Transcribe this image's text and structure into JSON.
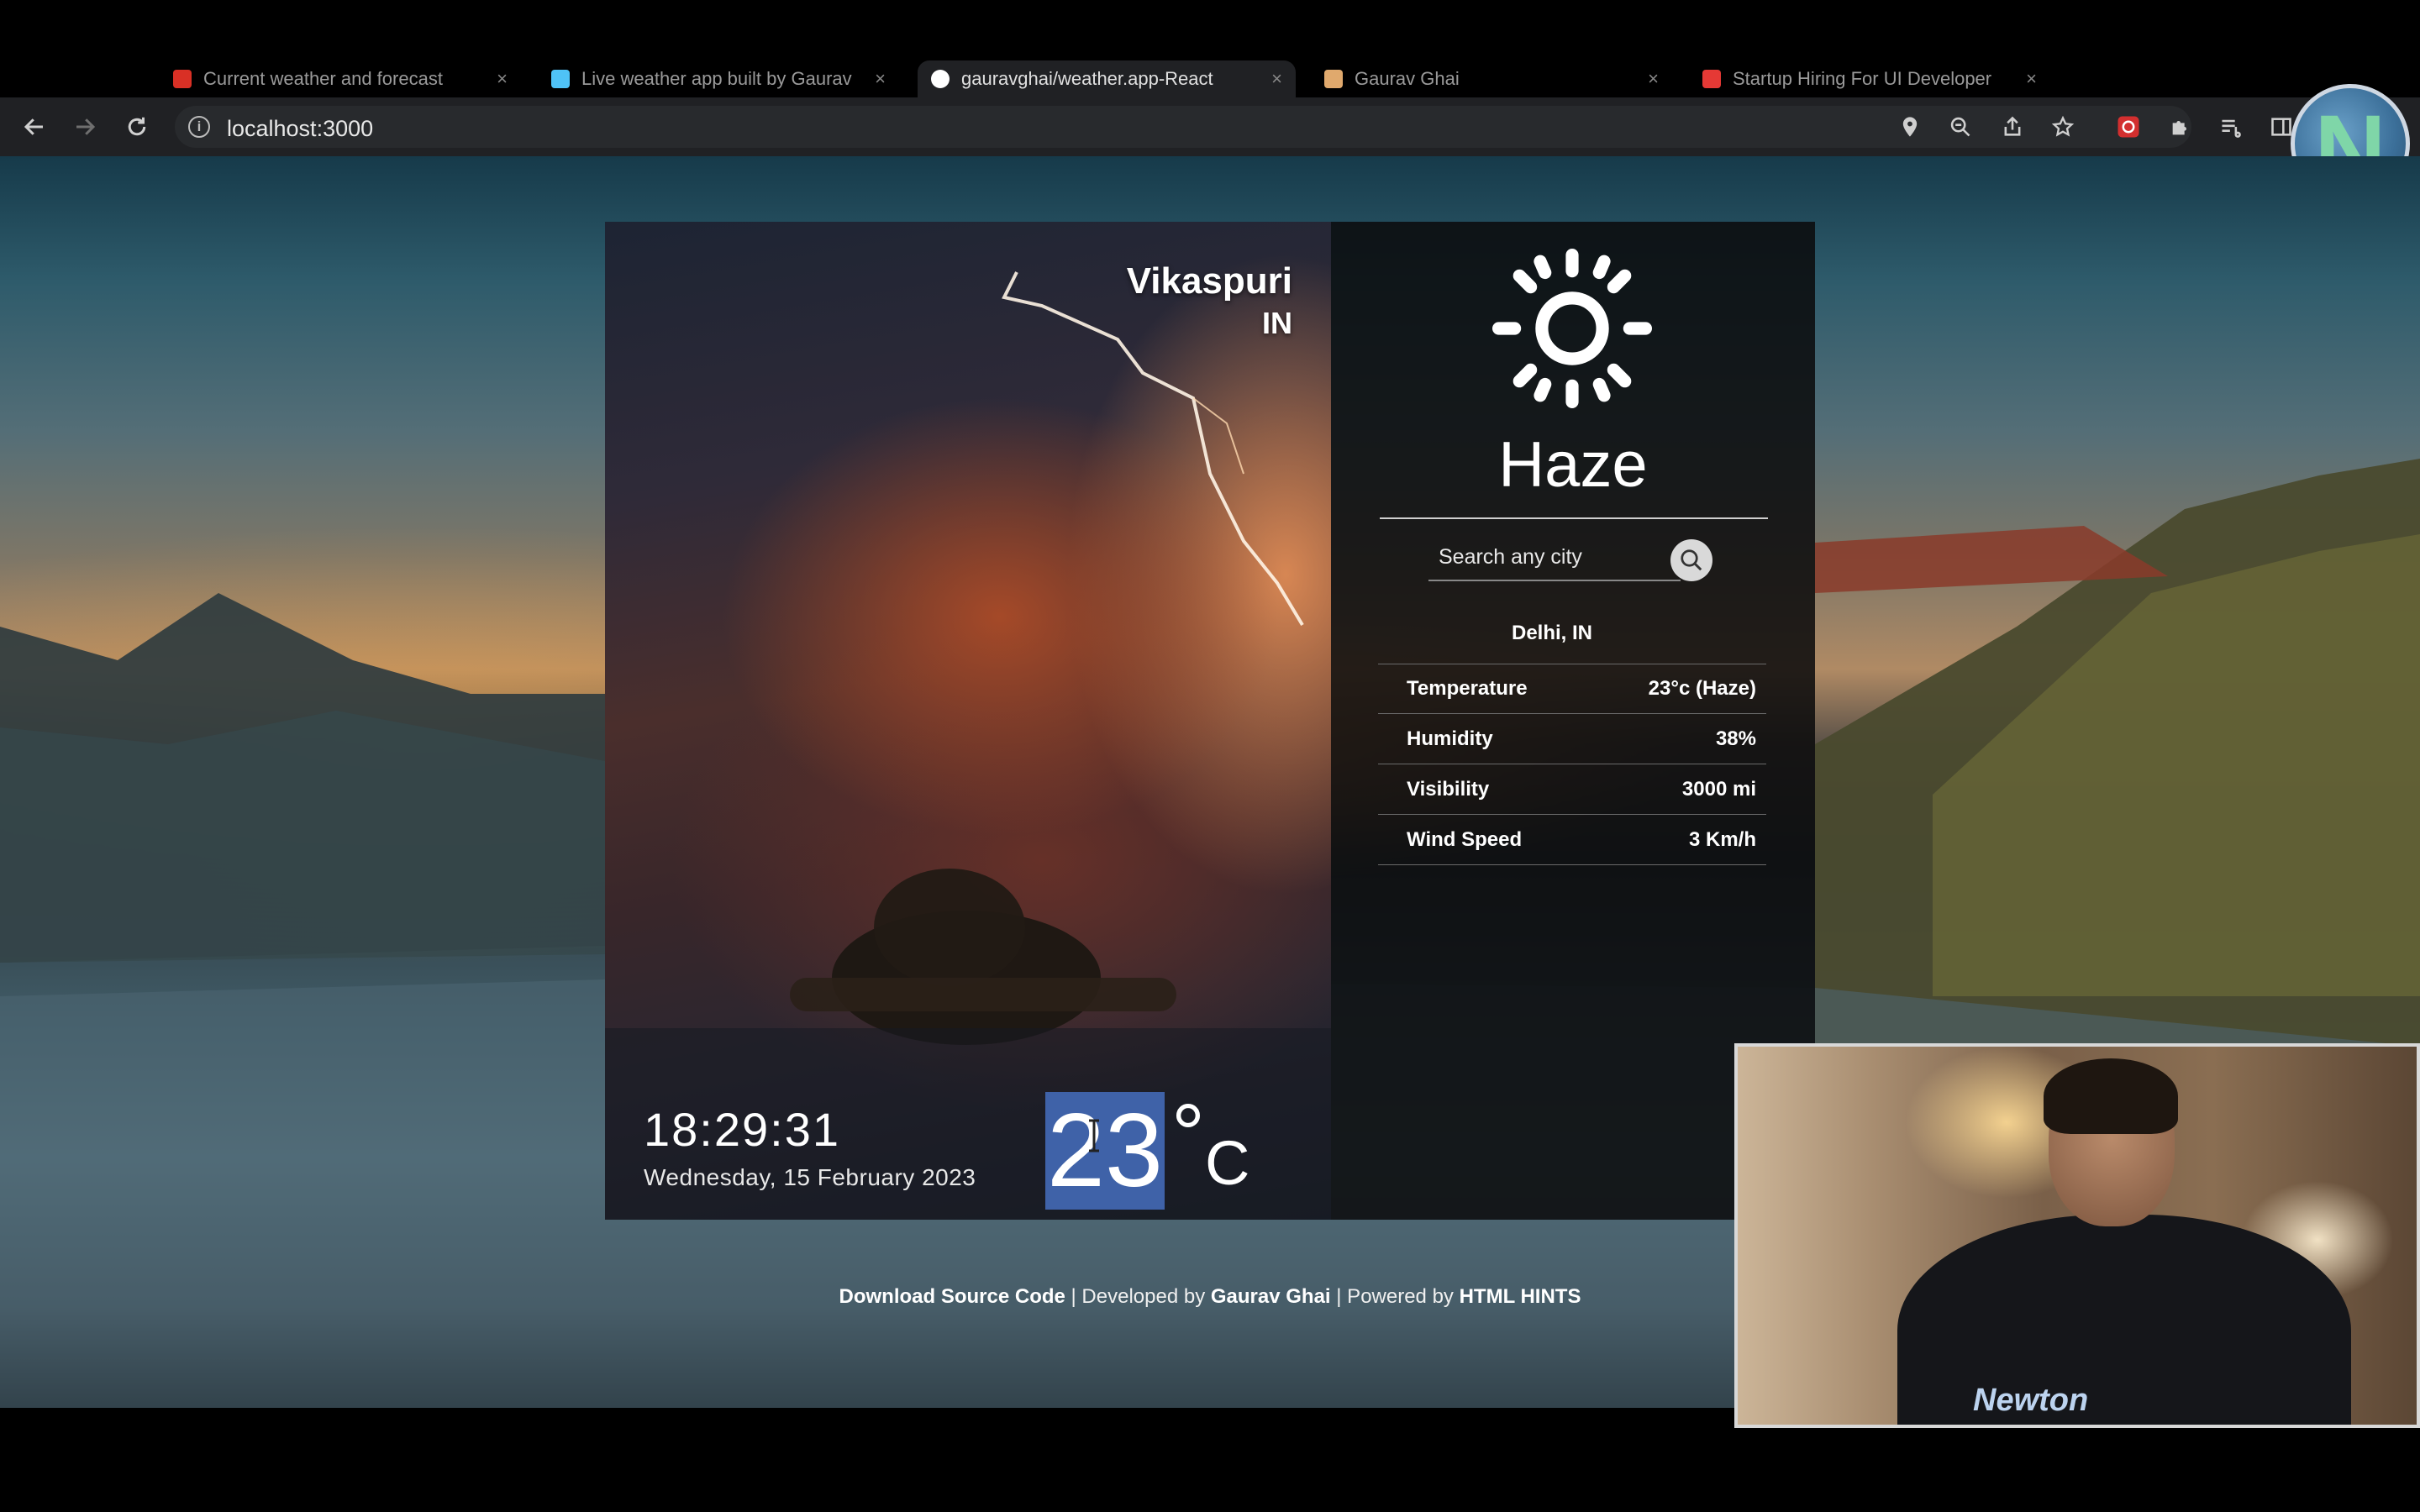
{
  "browser": {
    "tabs": [
      {
        "title": "Current weather and forecast",
        "favicon_color": "#d93025",
        "active": false
      },
      {
        "title": "Live weather app built by Gaurav",
        "favicon_color": "#4fc3f7",
        "active": false
      },
      {
        "title": "gauravghai/weather.app-React",
        "favicon_color": "#ffffff",
        "active": true
      },
      {
        "title": "Gaurav Ghai",
        "favicon_color": "#e0a96d",
        "active": false
      },
      {
        "title": "Startup Hiring For UI Developer",
        "favicon_color": "#e53935",
        "active": false
      }
    ],
    "close_glyph": "×",
    "url": "localhost:3000",
    "profile_initial": "N"
  },
  "weather": {
    "city": "Vikaspuri",
    "country": "IN",
    "time": "18:29:31",
    "date": "Wednesday, 15 February 2023",
    "temperature": "23",
    "degree_symbol": "°",
    "unit": "C",
    "condition": "Haze",
    "search_placeholder": "Search any city",
    "location": "Delhi, IN",
    "stats": [
      {
        "label": "Temperature",
        "value": "23°c (Haze)"
      },
      {
        "label": "Humidity",
        "value": "38%"
      },
      {
        "label": "Visibility",
        "value": "3000 mi"
      },
      {
        "label": "Wind Speed",
        "value": "3 Km/h"
      }
    ]
  },
  "footer": {
    "download": "Download Source Code",
    "sep1": " | Developed by ",
    "author": "Gaurav Ghai",
    "sep2": " | Powered by ",
    "powered": "HTML HINTS"
  },
  "webcam": {
    "hoodie_text": "Newton"
  },
  "colors": {
    "selection_highlight": "#3f62a8",
    "card_right_bg": "#0a0a0c",
    "browser_toolbar": "#202124"
  }
}
